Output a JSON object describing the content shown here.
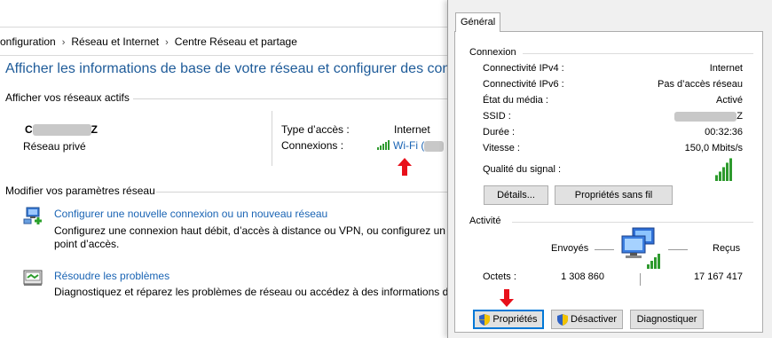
{
  "control_panel": {
    "breadcrumb": [
      "onfiguration",
      "Réseau et Internet",
      "Centre Réseau et partage"
    ],
    "heading": "Afficher les informations de base de votre réseau et configurer des conne",
    "active_networks_label": "Afficher vos réseaux actifs",
    "network": {
      "name_visible_prefix": "C",
      "name_visible_suffix": "Z",
      "type": "Réseau privé",
      "access_type_label": "Type d’accès :",
      "access_type_value": "Internet",
      "connections_label": "Connexions :",
      "connection_link": "Wi-Fi (",
      "connection_link_end": ")"
    },
    "modify_label": "Modifier vos paramètres réseau",
    "tasks": [
      {
        "title": "Configurer une nouvelle connexion ou un nouveau réseau",
        "desc_line1": "Configurez une connexion haut débit, d’accès à distance ou VPN, ou configurez un ro",
        "desc_line2": "point d’accès."
      },
      {
        "title": "Résoudre les problèmes",
        "desc_line1": "Diagnostiquez et réparez les problèmes de réseau ou accédez à des informations de d"
      }
    ]
  },
  "dialog": {
    "tab": "Général",
    "connection_group": "Connexion",
    "rows": [
      {
        "label": "Connectivité IPv4 :",
        "value": "Internet"
      },
      {
        "label": "Connectivité IPv6 :",
        "value": "Pas d’accès réseau"
      },
      {
        "label": "État du média :",
        "value": "Activé"
      },
      {
        "label": "SSID :",
        "value": "Z"
      },
      {
        "label": "Durée :",
        "value": "00:32:36"
      },
      {
        "label": "Vitesse :",
        "value": "150,0 Mbits/s"
      }
    ],
    "signal_label": "Qualité du signal :",
    "signal_bars": 5,
    "details_button": "Détails...",
    "wireless_props_button": "Propriétés sans fil",
    "activity_group": "Activité",
    "sent_label": "Envoyés",
    "received_label": "Reçus",
    "bytes_label": "Octets :",
    "bytes_sent": "1 308 860",
    "bytes_received": "17 167 417",
    "properties_button": "Propriétés",
    "disable_button": "Désactiver",
    "diagnose_button": "Diagnostiquer"
  },
  "colors": {
    "heading_blue": "#1e5b99",
    "link_blue": "#1a64b4",
    "signal_green": "#2e9a2e",
    "arrow_red": "#e8101a"
  }
}
